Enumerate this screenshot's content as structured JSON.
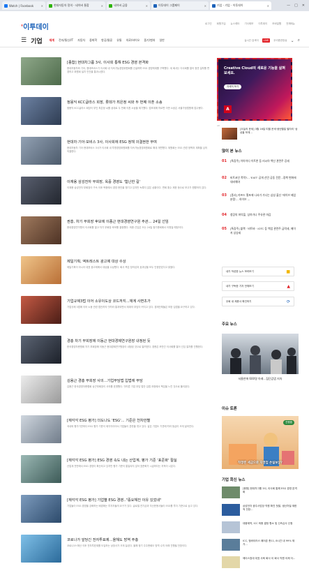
{
  "browser": {
    "tabs": [
      {
        "label": "Watch | Facebook",
        "color": "#1877f2",
        "active": false
      },
      {
        "label": "현대자동차 정의 - 네이버 통합",
        "color": "#2db400",
        "active": false
      },
      {
        "label": "네이버 금융",
        "color": "#2db400",
        "active": false
      },
      {
        "label": "이투데이 그룹페이",
        "color": "#1c62b9",
        "active": false
      },
      {
        "label": "기업 - 기업 - 이투데이",
        "color": "#1c62b9",
        "active": true
      }
    ],
    "window_controls": [
      "—",
      "□",
      "✕"
    ]
  },
  "header": {
    "logo_prefix": "'",
    "logo_text": "이투데이",
    "top_links": [
      "로그인",
      "회원가입",
      "뉴스레터",
      "기사제보",
      "이투데이",
      "모바일웹",
      "전체메뉴"
    ],
    "section": "기업",
    "nav": [
      "재계",
      "전자/통신/IT",
      "자동차",
      "중화학",
      "항공/물류",
      "유통",
      "의료/바이오",
      "중기/벤처",
      "일반"
    ],
    "live_label": "LIVE",
    "right_items": [
      "실시간 검색어",
      "SBS플러스",
      "이투데이TV",
      "우리증권방송"
    ]
  },
  "articles": [
    {
      "title": "[종합] 현대차그룹 3사, 이사회 통해 ESG 경영 본격화",
      "summary": "현대자동차와 기아, 현대모비스가 이사회 내 지속가능경영위원회를 신설하며 ESG 경영체계를 구축했다. 세 회사는 이사회를 열어 정관 일부를 변경하고 위원회 설치 안건을 통과시켰다.",
      "thumb": "#6e8b6a"
    },
    {
      "title": "정몽익 KCC글라스 회장, 롯데가 최은정 씨와 두 번째 이혼 소송",
      "summary": "정몽익 KCC글라스 회장이 부인 최은정 씨를 상대로 두 번째 이혼 소송을 제기했다. 법조계에 따르면 이번 소송은 서울가정법원에 접수됐다.",
      "thumb": "#4a5d78"
    },
    {
      "title": "현대차·기아·모비스 3사, 이사회에 ESG 정책 의결권한 부여",
      "summary": "현대자동차 기아 현대모비스 3사가 이사회 내 투명경영위원회를 지속가능경영위원회로 확대 개편했다. 위원회는 ESG 관련 정책과 계획을 심의 의결한다.",
      "thumb": "#6b7a8c"
    },
    {
      "title": "이재용 삼성전자 부회장, 옥중 경영도 '험난한 길'",
      "summary": "이재용 삼성전자 부회장이 구속 이후 옥중에서 경영 현안을 챙기고 있지만 녹록지 않은 상황이다. 면회 횟수 제한 등으로 보고가 원활하지 않다.",
      "thumb": "#3a3f4a"
    },
    {
      "title": "권홍, 차기 부회장 후보에 이종근 현대경영연구원 주관... 24일 선임",
      "summary": "현대경영연구원이 이사회를 열고 차기 부회장 후보를 결정했다. 최종 선임은 오는 24일 정기총회에서 이뤄질 예정이다.",
      "thumb": "#7a5a44"
    },
    {
      "title": "제일기획, 액트레스트 광고제 대상 수상",
      "summary": "제일기획이 아시아 대표 광고제에서 대상을 수상했다. 회사 측은 창의성과 효과성을 모두 인정받았다고 밝혔다.",
      "thumb": "#c78b48"
    },
    {
      "title": "기업규제3법 이어 소유이도상 코드까지...재계 사면초가",
      "summary": "기업규제 3법에 이어 노동 관련 법안까지 잇따라 통과되면서 재계의 부담이 커지고 있다. 경제단체들은 보완 입법을 요구하고 있다.",
      "thumb": "#8a3a2e"
    },
    {
      "title": "경총 차기 부회장에 이동근 현대경제연구원장 내정된 듯",
      "summary": "한국경영자총협회 차기 부회장에 이동근 현대경제연구원장이 내정된 것으로 알려졌다. 경총은 조만간 이사회를 열어 선임 절차를 진행한다.",
      "thumb": "#2f3540"
    },
    {
      "title": "김용근 경총 부회장 사의...기업부담법 입법에 부담",
      "summary": "김용근 한국경영자총협회 상근부회장이 사의를 표명했다. 잇따른 기업 부담 법안 입법 과정에서 책임을 느낀 것으로 풀이된다.",
      "thumb": "#d9d9d9"
    },
    {
      "title": "[재각각 ESG 평가] 더도나도 'ESG'... 기준은 천차만별",
      "summary": "국내외 평가기관마다 ESG 평가 기준이 제각각이어서 기업들이 혼란을 겪고 있다. 같은 기업도 기관에 따라 등급이 크게 달라진다.",
      "thumb": "#b0b8c2"
    },
    {
      "title": "[재각각 ESG 평가] ESG 경영 속도 내는 산업계, 평가 기준 '표준화' 절실",
      "summary": "산업계 전반에서 ESG 경영이 확산되고 있지만 평가 기준이 통일되지 않아 표준화가 시급하다는 지적이 나온다.",
      "thumb": "#6f8f8c"
    },
    {
      "title": "[재각각 ESG 평가] 기업별 ESG 경영..\"중요해진 이유 있었네\"",
      "summary": "기업들이 ESG 경영을 강화하는 배경에는 투자자들의 요구가 있다. 글로벌 연기금과 자산운용사들이 ESG를 투자 기준으로 삼고 있다.",
      "thumb": "#4f6e8f"
    },
    {
      "title": "코로나가 앞당긴 전자투표제...올해도 방역 주총",
      "summary": "코로나19 확산 이후 전자투표제를 도입하는 상장사가 크게 늘었다. 올해 정기 주주총회도 방역 수칙 아래 진행될 전망이다.",
      "thumb": "#4a8fbf"
    }
  ],
  "ad": {
    "title": "Creative Cloud의 새로운 기능을 살펴보세요.",
    "button": "자세히 보기",
    "logo": "A",
    "note": "AD"
  },
  "sidebar": {
    "hot_item": "[오늘의 운세] 3월 16일 띠별 운세·생년월일 별자리 '상상을 보게...",
    "popular_title": "많이 본 뉴스",
    "popular": [
      {
        "num": "01",
        "text": "[특징주] 이아이디·이트론 등 러시아 백신 관련주 강세"
      },
      {
        "num": "02",
        "text": "비트코인 폭락?... 'EXIT' 공개 선언 공동 전문...정책 변화에 대비해야"
      },
      {
        "num": "03",
        "text": "[종사] 카프드 횡포에 나서가 가나는 삼성 출신 '에이브 제업 분쟁'… 하이브 ..."
      },
      {
        "num": "04",
        "text": "청장의 파악을, 상하가나 주유관 마감"
      },
      {
        "num": "05",
        "text": "[특징주] 블랙 · 비트바 · IOTC 등 백업 관련주 급락세, 메이저 상승세"
      }
    ],
    "buttons": [
      {
        "label": "내가 작성한 뉴스 보러보기",
        "icon": "■",
        "color": "#f2b705"
      },
      {
        "label": "내가 구독한 기자 전체보기",
        "icon": "▲",
        "color": "#e2242a"
      },
      {
        "label": "우회 내 제휴사 확인하기",
        "icon": "♢",
        "color": "#1c62b9"
      }
    ],
    "main_news_title": "주요 뉴스",
    "main_news_caption": "서울만에 600명 아래...집단감염 지속",
    "issue_title": "이슈 토론",
    "issue_badge": "진행중",
    "issue_caption": "작정된 세금으로 자영업 손실보상?",
    "company_title": "기업 회신 뉴스",
    "company_news": [
      {
        "text": "[종합] 현대차그룹 3사, 이사회 통해 ESG 경영 본격화",
        "color": "#6e8b6a"
      },
      {
        "text": "삼성전자 광주사업장 직원 확진 첫발, 생산차질 제한적 전망...",
        "color": "#2b5c9e"
      },
      {
        "text": "대웅제약, ICC 최종 결정 항소 및 신속심사 신청",
        "color": "#b6c4d6"
      },
      {
        "text": "ICC, 첨바이러스 페어존 총11, 8시간 내 99% 제거...",
        "color": "#5a7d9a"
      },
      {
        "text": "에이스침대 대표 사퇴 회사 이 회사 직원 이제 더...",
        "color": "#e3d7a8"
      }
    ]
  }
}
